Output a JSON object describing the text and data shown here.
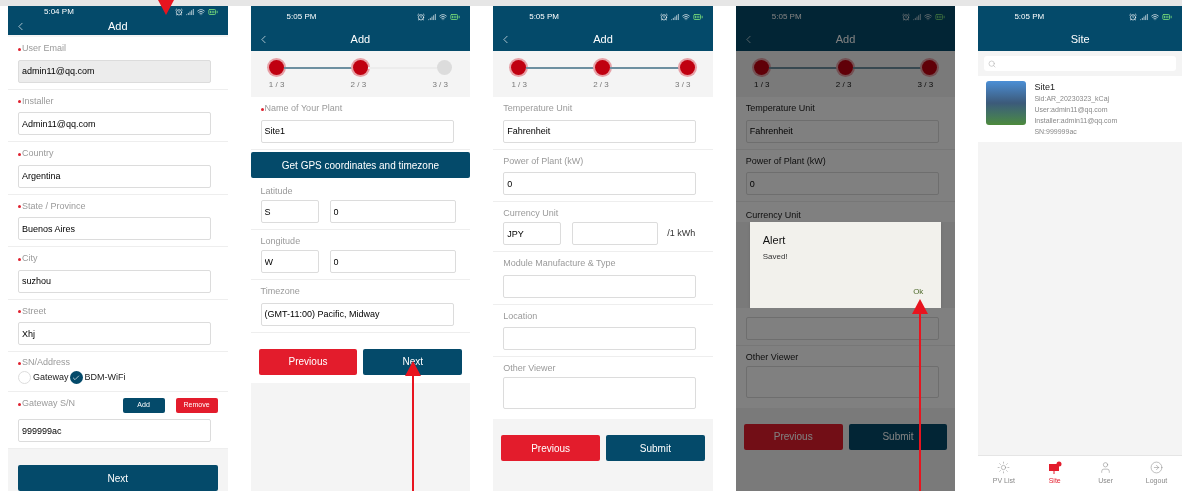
{
  "screens": [
    {
      "kind": "form",
      "time": "5:04 PM",
      "title": "Add",
      "dimmed": false,
      "buttons_on_panel": false,
      "sections": [
        {
          "kind": "field",
          "label": "User Email",
          "required": true,
          "value": "admin11@qq.com",
          "disabled": true
        },
        {
          "kind": "field",
          "label": "Installer",
          "required": true,
          "value": "Admin11@qq.com",
          "disabled": false
        },
        {
          "kind": "field",
          "label": "Country",
          "required": true,
          "value": "Argentina",
          "disabled": false
        },
        {
          "kind": "field",
          "label": "State / Province",
          "required": true,
          "value": "Buenos Aires",
          "disabled": false
        },
        {
          "kind": "field",
          "label": "City",
          "required": true,
          "value": "suzhou",
          "disabled": false
        },
        {
          "kind": "field",
          "label": "Street",
          "required": true,
          "value": "Xhj",
          "disabled": false
        },
        {
          "kind": "radio",
          "label": "SN/Address",
          "required": true,
          "options": [
            {
              "label": "Gateway",
              "selected": false
            },
            {
              "label": "BDM-WiFi",
              "selected": true
            }
          ]
        },
        {
          "kind": "gateway",
          "label": "Gateway S/N",
          "required": true,
          "add": "Add",
          "remove": "Remove",
          "value": "999999ac"
        }
      ],
      "buttons": [
        {
          "label": "Next",
          "kind": "primary"
        }
      ]
    },
    {
      "kind": "form",
      "time": "5:05 PM",
      "title": "Add",
      "dimmed": false,
      "buttons_on_panel": true,
      "steps": [
        {
          "label": "1 / 3",
          "done": true
        },
        {
          "label": "2 / 3",
          "done": true
        },
        {
          "label": "3 / 3",
          "done": false
        }
      ],
      "sections": [
        {
          "kind": "field",
          "label": "Name of Your Plant",
          "required": true,
          "value": "Site1"
        },
        {
          "kind": "action",
          "label": "Get GPS coordinates and timezone"
        },
        {
          "kind": "pair",
          "label": "Latitude",
          "first": "S",
          "second": "0"
        },
        {
          "kind": "pair",
          "label": "Longitude",
          "first": "W",
          "second": "0"
        },
        {
          "kind": "field",
          "label": "Timezone",
          "value": "(GMT-11:00) Pacific, Midway"
        }
      ],
      "buttons": [
        {
          "label": "Previous",
          "kind": "danger"
        },
        {
          "label": "Next",
          "kind": "primary"
        }
      ]
    },
    {
      "kind": "form",
      "time": "5:05 PM",
      "title": "Add",
      "dimmed": false,
      "buttons_on_panel": false,
      "steps": [
        {
          "label": "1 / 3",
          "done": true
        },
        {
          "label": "2 / 3",
          "done": true
        },
        {
          "label": "3 / 3",
          "done": true
        }
      ],
      "sections": [
        {
          "kind": "field",
          "label": "Temperature Unit",
          "value": "Fahrenheit"
        },
        {
          "kind": "field",
          "label": "Power of Plant (kW)",
          "value": "0"
        },
        {
          "kind": "pair",
          "label": "Currency Unit",
          "first": "JPY",
          "suffix": "/1 kWh"
        },
        {
          "kind": "field",
          "label": "Module Manufacture & Type"
        },
        {
          "kind": "field",
          "label": "Location"
        },
        {
          "kind": "area",
          "label": "Other Viewer"
        }
      ],
      "buttons": [
        {
          "label": "Previous",
          "kind": "danger"
        },
        {
          "label": "Submit",
          "kind": "primary"
        }
      ]
    },
    {
      "kind": "form",
      "time": "5:05 PM",
      "title": "Add",
      "dimmed": true,
      "buttons_on_panel": false,
      "steps": [
        {
          "label": "1 / 3",
          "done": true
        },
        {
          "label": "2 / 3",
          "done": true
        },
        {
          "label": "3 / 3",
          "done": true
        }
      ],
      "sections": [
        {
          "kind": "field",
          "label": "Temperature Unit",
          "value": "Fahrenheit"
        },
        {
          "kind": "field",
          "label": "Power of Plant (kW)",
          "value": "0"
        },
        {
          "kind": "label",
          "label": "Currency Unit"
        },
        {
          "kind": "alert",
          "title": "Alert",
          "message": "Saved!",
          "button": "Ok"
        },
        {
          "kind": "bare_field"
        },
        {
          "kind": "area",
          "label": "Other Viewer"
        }
      ],
      "buttons": [
        {
          "label": "Previous",
          "kind": "danger"
        },
        {
          "label": "Submit",
          "kind": "primary"
        }
      ]
    },
    {
      "kind": "list",
      "time": "5:05 PM",
      "title": "Site",
      "sites": [
        {
          "name": "Site1",
          "lines": [
            "Sid:AR_20230323_kCaj",
            "User:admin11@qq.com",
            "Installer:admin11@qq.com",
            "SN:999999ac"
          ]
        }
      ],
      "tabs": [
        {
          "label": "PV List",
          "selected": false
        },
        {
          "label": "Site",
          "selected": true
        },
        {
          "label": "User",
          "selected": false
        },
        {
          "label": "Logout",
          "selected": false
        }
      ]
    }
  ]
}
